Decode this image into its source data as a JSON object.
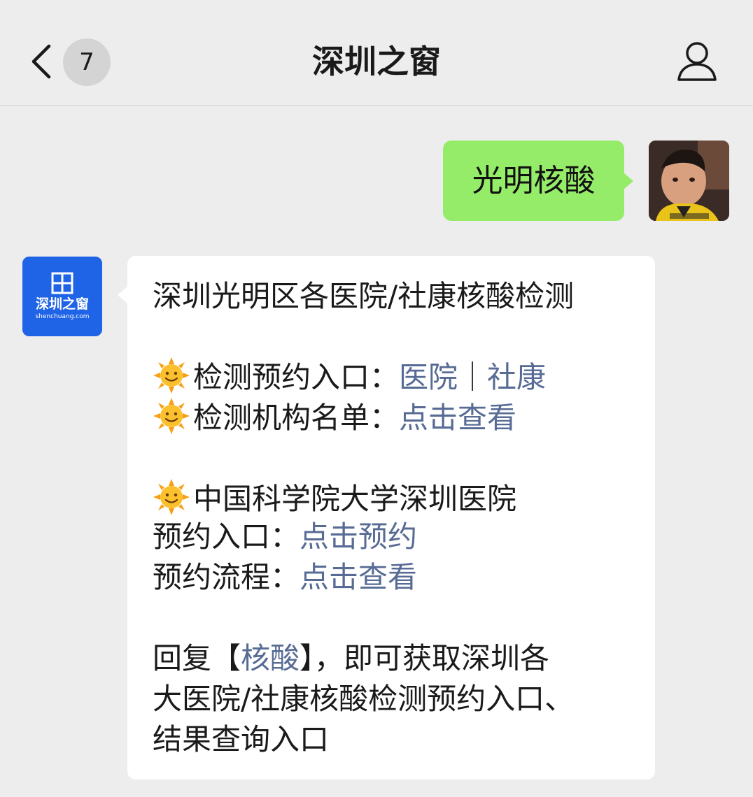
{
  "header": {
    "title": "深圳之窗",
    "unread_count": "7",
    "back_icon": "chevron-left-icon",
    "profile_icon": "person-outline-icon"
  },
  "outgoing": {
    "text": "光明核酸",
    "bubble_color": "#95ec69"
  },
  "incoming": {
    "avatar_brand": "深圳之窗",
    "avatar_url_text": "shenchuang.com",
    "heading": "深圳光明区各医院/社康核酸检测",
    "booking_label": "检测预约入口：",
    "booking_link_hospital": "医院",
    "booking_separator": "｜",
    "booking_link_community": "社康",
    "institutions_label": "检测机构名单：",
    "institutions_link": "点击查看",
    "hospital_name": "中国科学院大学深圳医院",
    "appointment_label": "预约入口：",
    "appointment_link": "点击预约",
    "process_label": "预约流程：",
    "process_link": "点击查看",
    "reply_prefix": "回复【",
    "reply_link": "核酸",
    "reply_suffix": "】，即可获取深圳各",
    "reply_line2": "大医院/社康核酸检测预约入口、",
    "reply_line3": "结果查询入口",
    "emoji_icon": "sun-face-emoji",
    "link_color": "#576b95"
  }
}
